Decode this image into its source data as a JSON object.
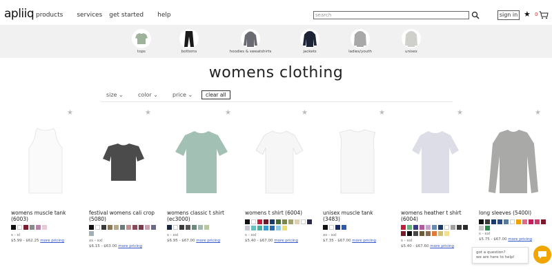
{
  "header": {
    "logo": "apliiq",
    "nav": [
      "products",
      "services",
      "get started",
      "help"
    ],
    "search_placeholder": "search",
    "signin": "sign in",
    "cart_count": "0"
  },
  "categories": [
    "tops",
    "bottoms",
    "hoodies & sweatshirts",
    "jackets",
    "ladies/youth",
    "unisex"
  ],
  "page_title": "womens clothing",
  "filters": {
    "size": "size",
    "color": "color",
    "price": "price",
    "clear": "clear all"
  },
  "products": [
    {
      "name": "womens muscle tank",
      "code": "(6003)",
      "sizes": "s - xl",
      "price": "$5.99 - $62.25",
      "more": "more pricing",
      "colors": [
        "#111111",
        "#ffffff",
        "#7a1b2e",
        "#8a8a8a",
        "#b784a7",
        "#e9c8d9"
      ]
    },
    {
      "name": "festival womens cali crop",
      "code": "(5080)",
      "sizes": "xs - xxl",
      "price": "$6.15 - $63.00",
      "more": "more pricing",
      "colors": [
        "#111111",
        "#ffffff",
        "#3a3a3a",
        "#8a7a5a",
        "#b5a98a",
        "#6b7d7a",
        "#c48c8c",
        "#8a4a5a",
        "#7a3a4a",
        "#c9a0b0",
        "#6a6a8a",
        "#a0b0b8"
      ]
    },
    {
      "name": "womens classic t shirt",
      "code": "(ec3000)",
      "sizes": "s - xxl",
      "price": "$6.95 - $67.00",
      "more": "more pricing",
      "colors": [
        "#1a2540",
        "#ffffff",
        "#3a3a3a",
        "#555555",
        "#6a8a7a",
        "#9fb8b0",
        "#b8c9a0"
      ]
    },
    {
      "name": "womens t shirt (6004)",
      "code": "",
      "sizes": "s - xxl",
      "price": "$5.40 - $67.00",
      "more": "more pricing",
      "colors": [
        "#111111",
        "#ffffff",
        "#c41e3a",
        "#6a1a2a",
        "#1a3a6a",
        "#4a6a3a",
        "#7a8a4a",
        "#a0a070",
        "#e0d0b0",
        "#ffffff",
        "#2a2a4a",
        "#c8c8d0",
        "#6ac0c0",
        "#4ab0a0",
        "#3a9ad0",
        "#2a6ab0",
        "#90c8e8",
        "#e8e070"
      ]
    },
    {
      "name": "unisex muscle tank",
      "code": "(3483)",
      "sizes": "xs - xxl",
      "price": "$7.35 - $67.00",
      "more": "more pricing",
      "colors": [
        "#111111",
        "#ffffff",
        "#1a2a5a",
        "#2a5ab0"
      ]
    },
    {
      "name": "womens heather t shirt",
      "code": "(6004)",
      "sizes": "s - xxl",
      "price": "$5.40 - $67.60",
      "more": "more pricing",
      "colors": [
        "#c41e3a",
        "#6ab07a",
        "#3a3a8a",
        "#b05aa0",
        "#c8a0d0",
        "#6a8ab0",
        "#1a3a6a",
        "#ffffff",
        "#a0a0a0",
        "#3a3a3a",
        "#2a2a2a",
        "#7a1a2a",
        "#111111",
        "#4a4a4a",
        "#6a5a3a",
        "#8a6a4a",
        "#e07a3a",
        "#d0c070",
        "#f0e090"
      ]
    },
    {
      "name": "long sleeves (5400l)",
      "code": "",
      "sizes": "s - xxl",
      "price": "$5.75 - $67.00",
      "more": "more pricing",
      "colors": [
        "#111111",
        "#3a3a3a",
        "#1a3a6a",
        "#2a4a8a",
        "#5a7a9a",
        "#ffffff",
        "#f0a000",
        "#e06a8a",
        "#c41e5a",
        "#d03a6a",
        "#7a1a2a",
        "#c8c8c8",
        "#2a8a4a"
      ]
    }
  ],
  "chat": {
    "line1": "got a question?",
    "line2": "we are here to help!"
  },
  "icons": {
    "search": "search-icon",
    "star": "star-icon",
    "cart": "cart-icon",
    "chat": "chat-icon"
  }
}
